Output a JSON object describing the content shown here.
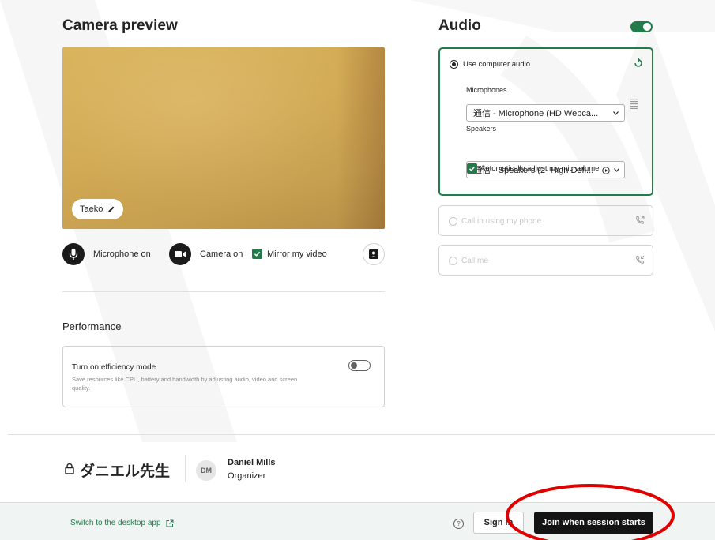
{
  "camera": {
    "title": "Camera preview",
    "name_tag": "Taeko",
    "mic_label": "Microphone on",
    "cam_label": "Camera on",
    "mirror_label": "Mirror my video",
    "mirror_checked": true
  },
  "performance": {
    "title": "Performance",
    "efficiency_title": "Turn on efficiency mode",
    "efficiency_desc": "Save resources like CPU, battery and bandwidth by adjusting audio, video and screen quality.",
    "efficiency_on": false
  },
  "audio": {
    "title": "Audio",
    "enabled": true,
    "use_computer_audio": "Use computer audio",
    "microphones_label": "Microphones",
    "microphone_value": "通信 - Microphone (HD Webca...",
    "speakers_label": "Speakers",
    "speaker_value": "通信 - Speakers (2- High Defi...",
    "auto_adjust_label": "Automatically adjust my mic volume",
    "auto_adjust_checked": true,
    "call_in_label": "Call in using my phone",
    "call_me_label": "Call me"
  },
  "meeting": {
    "title": "ダニエル先生",
    "organizer_initials": "DM",
    "organizer_name": "Daniel Mills",
    "organizer_role": "Organizer"
  },
  "footer": {
    "desktop_app_link": "Switch to the desktop app",
    "sign_in_label": "Sign in",
    "join_label": "Join when session starts"
  },
  "colors": {
    "accent": "#237b4b",
    "primary_button": "#141414",
    "annotation": "#e00000"
  },
  "icons": {
    "mic": "microphone-icon",
    "camera": "video-camera-icon",
    "edit": "pencil-icon",
    "background": "person-frame-icon",
    "refresh": "refresh-icon",
    "mic_level": "level-bars-icon",
    "play": "play-circle-icon",
    "phone_out": "phone-outgoing-icon",
    "phone_in": "phone-incoming-icon",
    "lock": "lock-icon",
    "external": "external-link-icon",
    "help": "help-circle-icon"
  }
}
